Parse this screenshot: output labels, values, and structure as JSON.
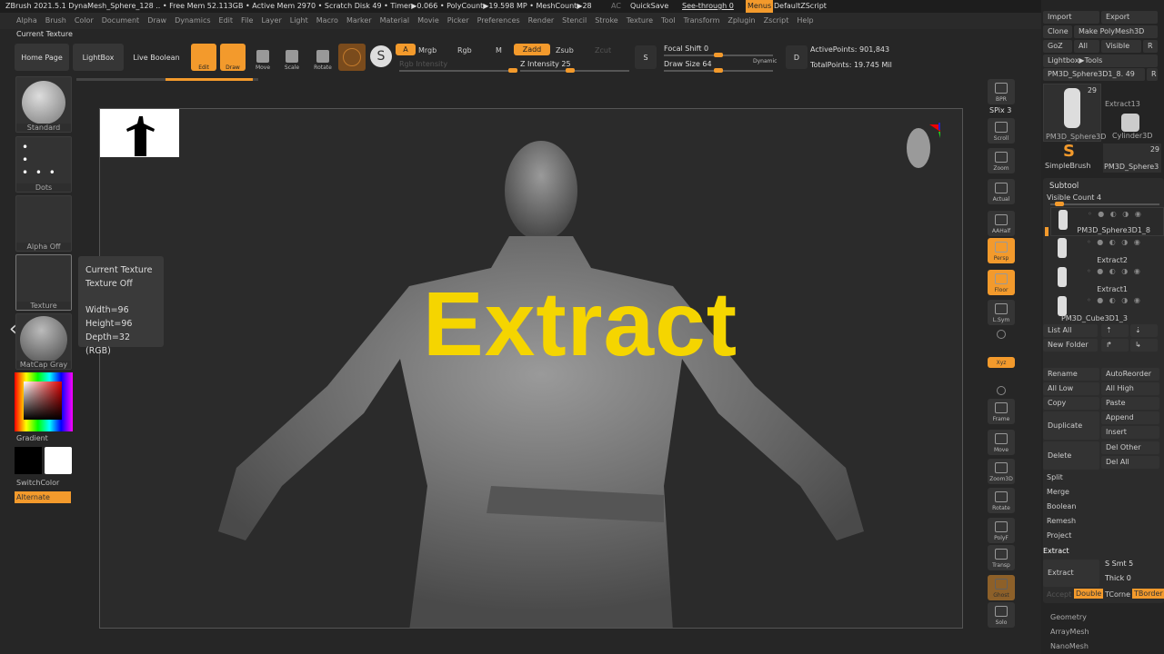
{
  "titlebar": {
    "text": "ZBrush 2021.5.1   DynaMesh_Sphere_128   .. • Free Mem 52.113GB • Active Mem 2970 • Scratch Disk 49 •  Timer▶0.066 • PolyCount▶19.598 MP  • MeshCount▶28",
    "ac": "AC",
    "quicksave": "QuickSave",
    "see_through": "See-through  0",
    "menus": "Menus",
    "script": "DefaultZScript"
  },
  "menu": [
    "Alpha",
    "Brush",
    "Color",
    "Document",
    "Draw",
    "Dynamics",
    "Edit",
    "File",
    "Layer",
    "Light",
    "Macro",
    "Marker",
    "Material",
    "Movie",
    "Picker",
    "Preferences",
    "Render",
    "Stencil",
    "Stroke",
    "Texture",
    "Tool",
    "Transform",
    "Zplugin",
    "Zscript",
    "Help"
  ],
  "palette_title": "Current Texture",
  "shelf": {
    "home": "Home Page",
    "lightbox": "LightBox",
    "live_boolean": "Live Boolean",
    "edit": "Edit",
    "draw": "Draw",
    "move": "Move",
    "scale": "Scale",
    "rotate": "Rotate",
    "a": "A",
    "mrgb": "Mrgb",
    "rgb": "Rgb",
    "m": "M",
    "zadd": "Zadd",
    "zsub": "Zsub",
    "zcut": "Zcut",
    "rgb_intensity": "Rgb Intensity",
    "z_intensity": "Z Intensity 25",
    "focal_shift": "Focal Shift 0",
    "draw_size": "Draw Size 64",
    "dynamic": "Dynamic",
    "active_points": "ActivePoints: 901,843",
    "total_points": "TotalPoints: 19.745 Mil"
  },
  "left": {
    "brush": "Standard",
    "stroke": "Dots",
    "alpha": "Alpha Off",
    "texture": "Texture",
    "material": "MatCap Gray",
    "gradient": "Gradient",
    "switch_color": "SwitchColor",
    "alternate": "Alternate"
  },
  "tooltip": {
    "l1": "Current Texture",
    "l2": "Texture Off",
    "l3": "Width=96",
    "l4": "Height=96",
    "l5": "Depth=32 (RGB)"
  },
  "overlay_title": "Extract",
  "right_toolbar": [
    "BPR",
    "SPix 3",
    "Scroll",
    "Zoom",
    "Actual",
    "AAHalf",
    "Persp",
    "Floor",
    "L.Sym",
    "",
    "Xyz",
    "",
    "Frame",
    "Move",
    "Zoom3D",
    "Rotate",
    "PolyF",
    "Transp",
    "Ghost",
    "Solo"
  ],
  "tool": {
    "import": "Import",
    "export": "Export",
    "clone": "Clone",
    "make_polymesh": "Make PolyMesh3D",
    "goz": "GoZ",
    "all": "All",
    "visible": "Visible",
    "r": "R",
    "lightbox_tools": "Lightbox▶Tools",
    "current": "PM3D_Sphere3D1_8. 49",
    "thumbs": [
      "PM3D_Sphere3D",
      "Extract13",
      "Cylinder3D",
      "SimpleBrush",
      "PM3D_Sphere3"
    ],
    "thumb_counts": [
      "29",
      "29"
    ]
  },
  "subtool": {
    "title": "Subtool",
    "visible_count": "Visible Count 4",
    "items": [
      "PM3D_Sphere3D1_8",
      "Extract2",
      "Extract1",
      "PM3D_Cube3D1_3"
    ],
    "list_all": "List All",
    "new_folder": "New Folder",
    "rename": "Rename",
    "autoreorder": "AutoReorder",
    "all_low": "All Low",
    "all_high": "All High",
    "copy": "Copy",
    "paste": "Paste",
    "duplicate": "Duplicate",
    "append": "Append",
    "insert": "Insert",
    "delete": "Delete",
    "del_other": "Del Other",
    "del_all": "Del All",
    "sections": [
      "Split",
      "Merge",
      "Boolean",
      "Remesh",
      "Project"
    ],
    "extract_section": "Extract",
    "extract_btn": "Extract",
    "s_smt": "S Smt 5",
    "thick": "Thick 0",
    "accept": "Accept",
    "double": "Double",
    "tcorne": "TCorne",
    "tborder": "TBorder"
  },
  "tool_sections": [
    "Geometry",
    "ArrayMesh",
    "NanoMesh"
  ],
  "colors": {
    "accent": "#f39a2c",
    "title_text": "#f5d500",
    "bg": "#262626"
  }
}
